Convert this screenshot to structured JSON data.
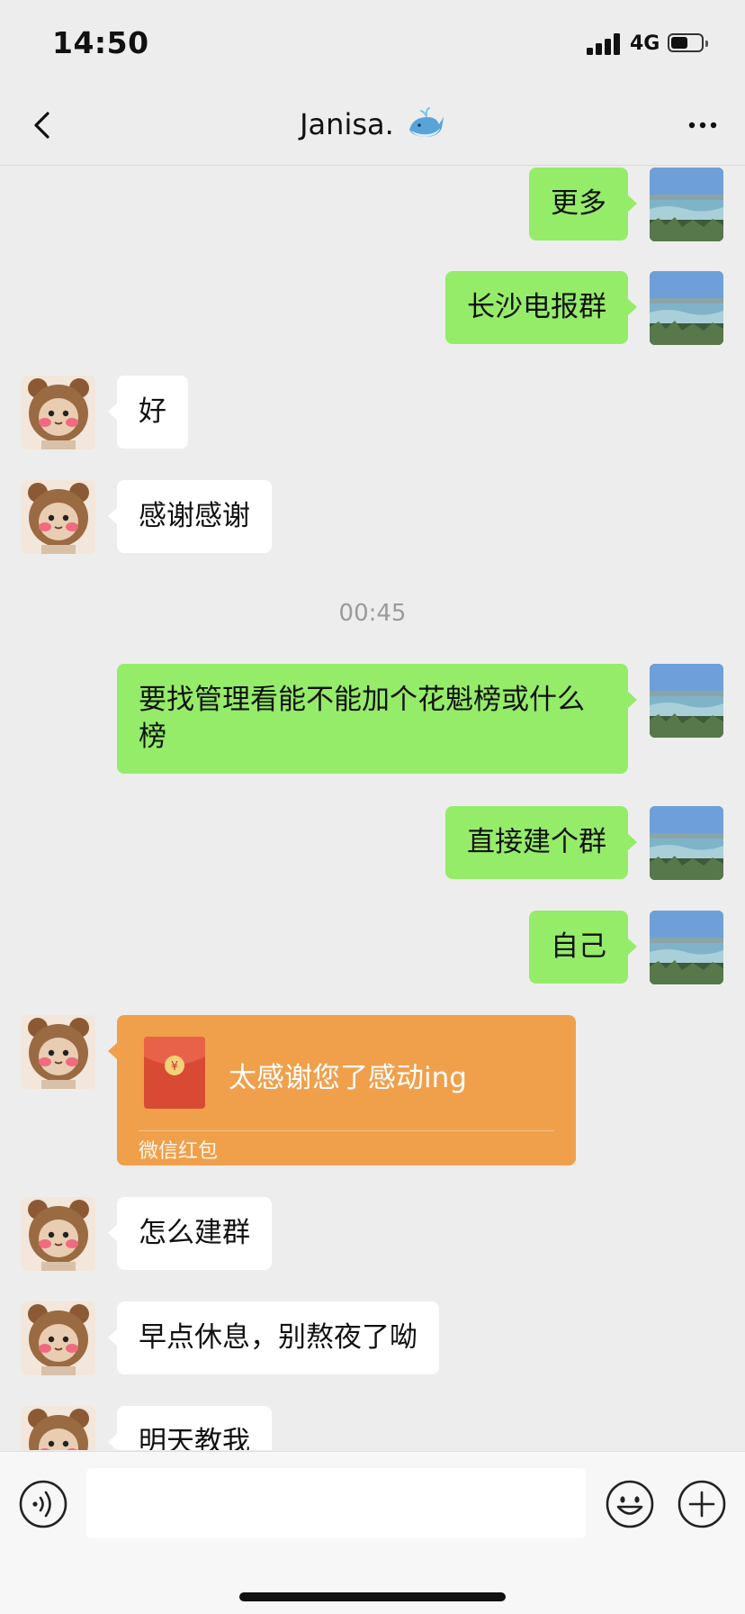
{
  "status_bar": {
    "time": "14:50",
    "network": "4G",
    "battery_level": 0.55
  },
  "header": {
    "title": "Janisa.",
    "back_icon": "chevron-left-icon",
    "more_icon": "more-dots-icon",
    "title_emoji": "whale"
  },
  "messages": [
    {
      "sender": "me",
      "text": "更多"
    },
    {
      "sender": "me",
      "text": "长沙电报群"
    },
    {
      "sender": "contact",
      "text": "好"
    },
    {
      "sender": "contact",
      "text": "感谢感谢"
    },
    {
      "type": "time",
      "text": "00:45"
    },
    {
      "sender": "me",
      "text": "要找管理看能不能加个花魁榜或什么榜"
    },
    {
      "sender": "me",
      "text": "直接建个群"
    },
    {
      "sender": "me",
      "text": "自己"
    },
    {
      "sender": "contact",
      "type": "red_packet",
      "text": "太感谢您了感动ing",
      "label": "微信红包"
    },
    {
      "sender": "contact",
      "text": "怎么建群"
    },
    {
      "sender": "contact",
      "text": "早点休息，别熬夜了呦"
    },
    {
      "sender": "contact",
      "text": "明天教我"
    }
  ],
  "input_bar": {
    "voice_icon": "voice-icon",
    "emoji_icon": "emoji-icon",
    "plus_icon": "plus-icon",
    "input_value": ""
  },
  "colors": {
    "background": "#ededed",
    "outgoing_bubble": "#95ec69",
    "incoming_bubble": "#ffffff",
    "red_packet": "#f0a04b",
    "time_label": "#9b9b9b"
  }
}
